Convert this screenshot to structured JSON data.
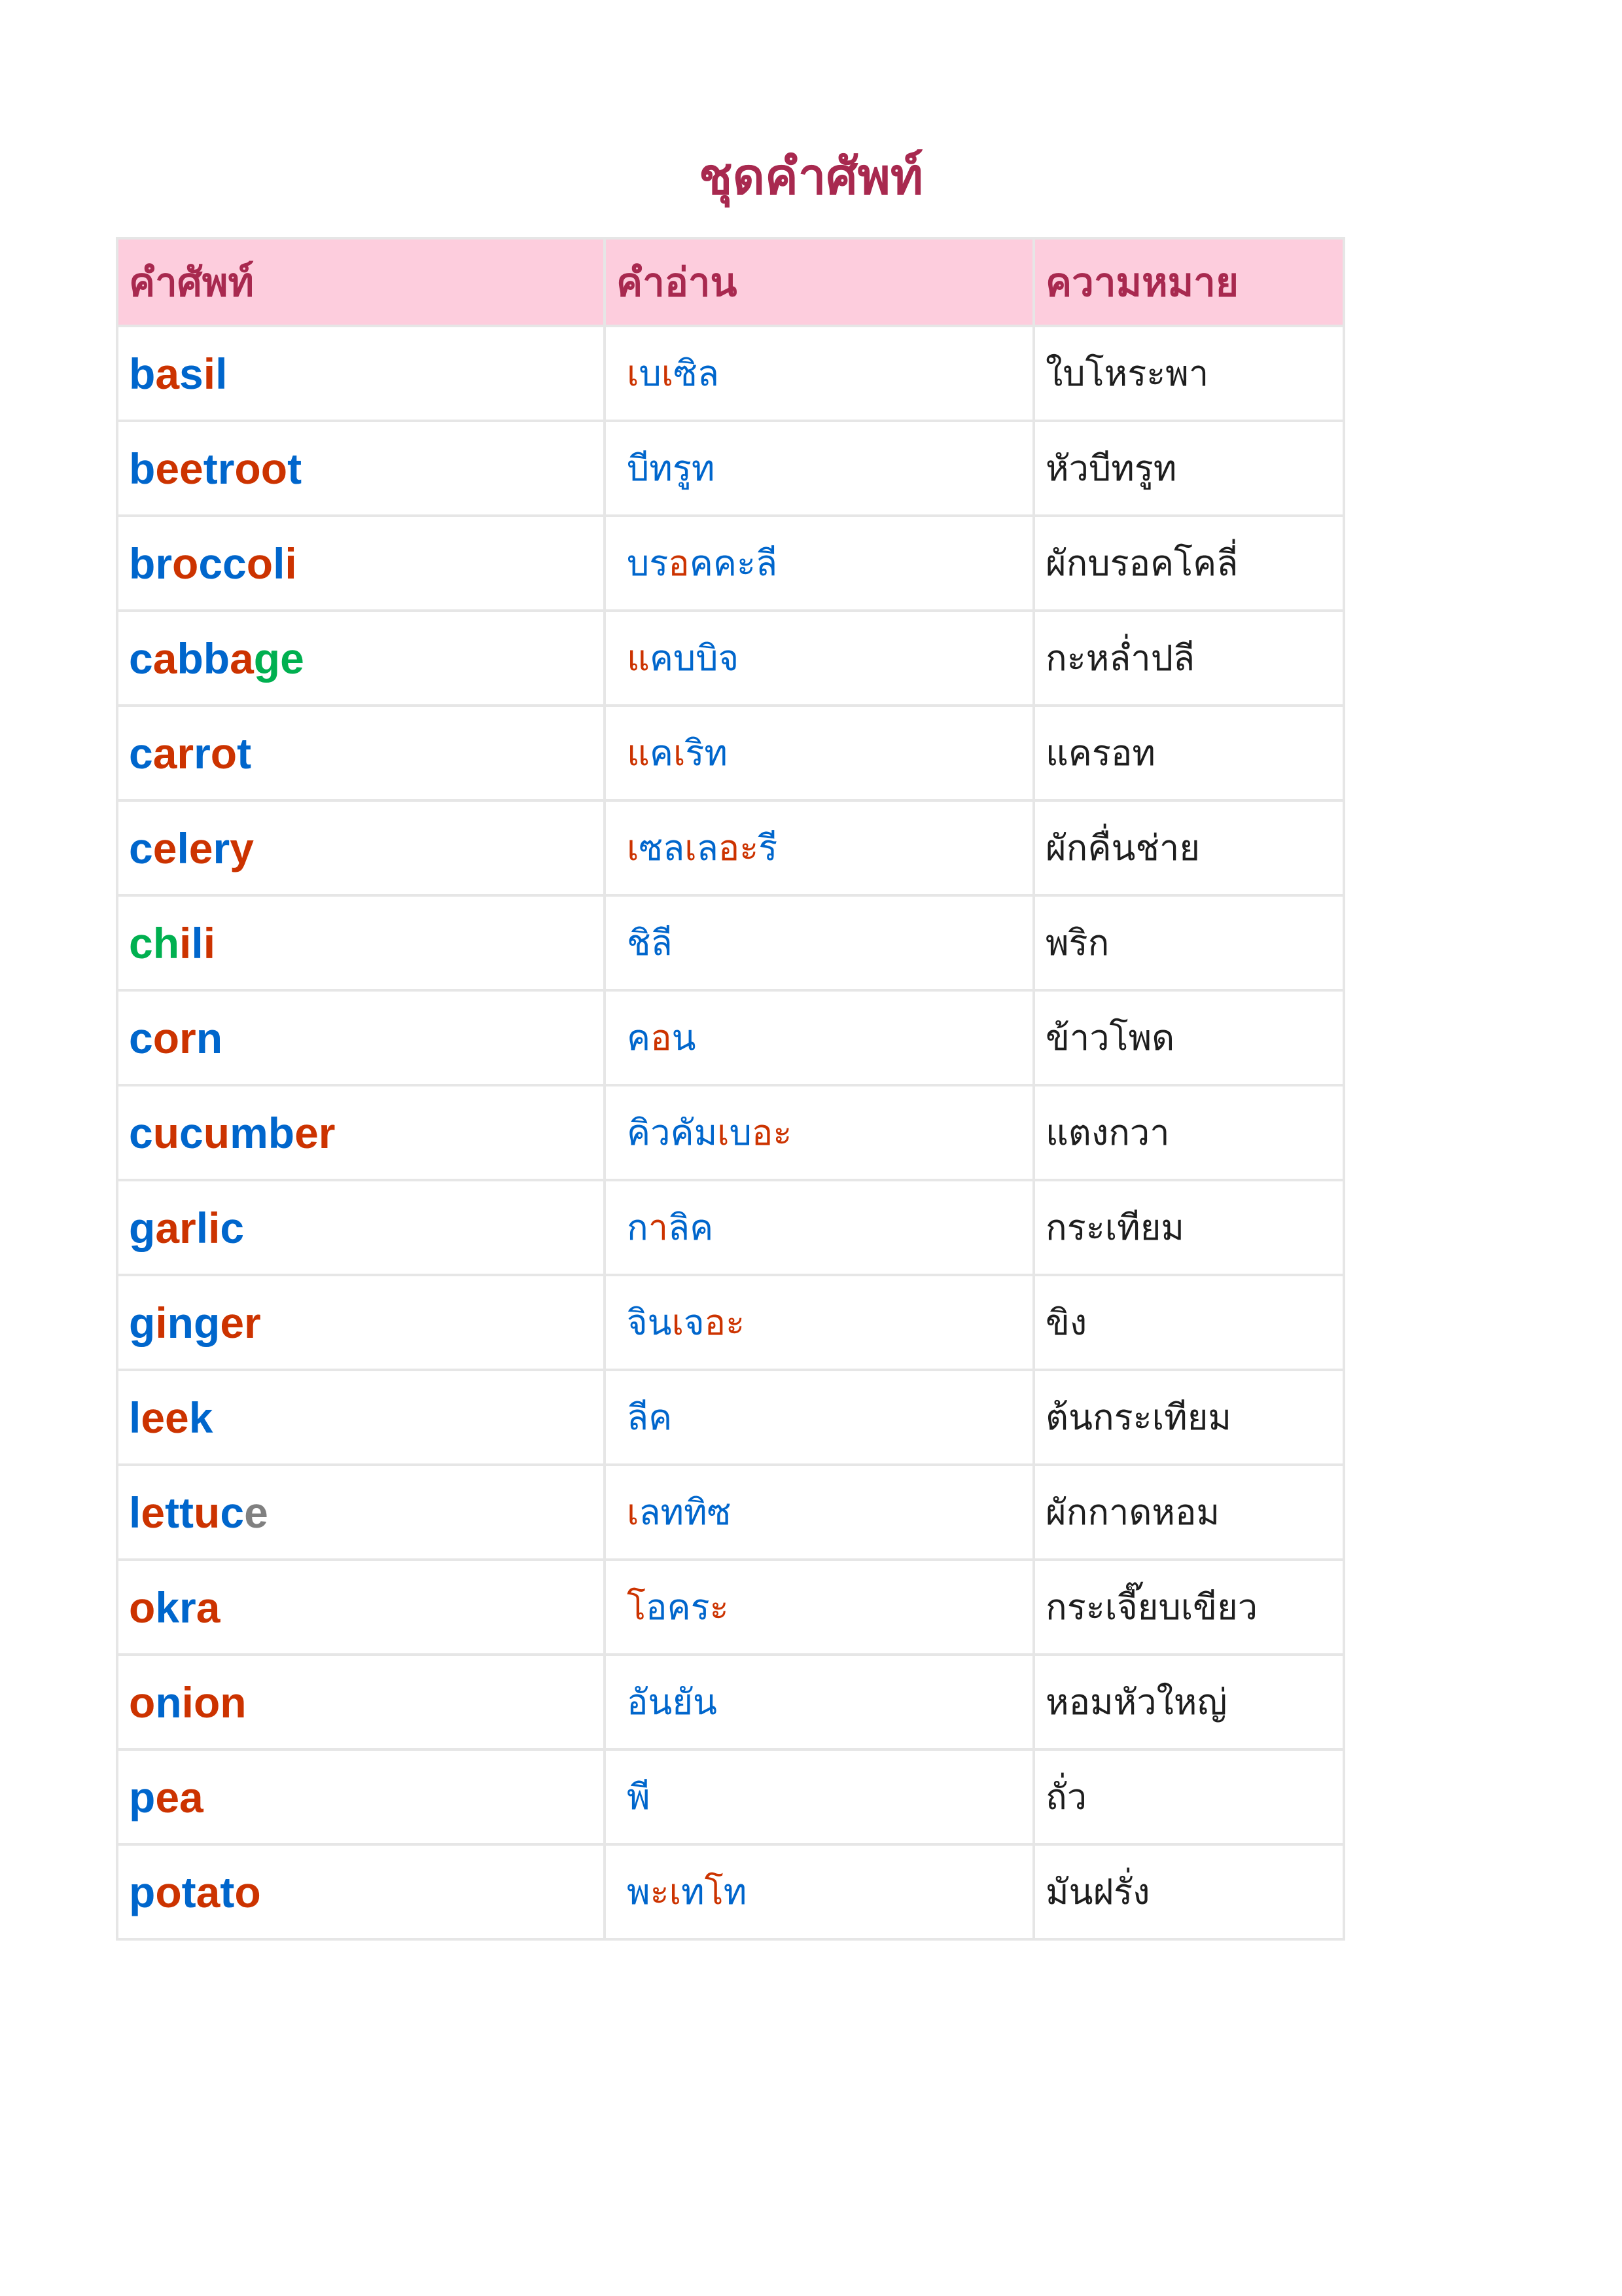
{
  "title": "ชุดคำศัพท์",
  "colors": {
    "title": "#a8294f",
    "header_bg": "#fdcddd",
    "border": "#e6e6e6",
    "blue": "#0066cc",
    "red": "#cc3300",
    "green": "#00b050",
    "gray": "#808080",
    "meaning": "#1e1e1e"
  },
  "headers": [
    "คำศัพท์",
    "คำอ่าน",
    "ความหมาย"
  ],
  "rows": [
    {
      "word": [
        [
          "b",
          "blue"
        ],
        [
          "a",
          "red"
        ],
        [
          "s",
          "blue"
        ],
        [
          "i",
          "red"
        ],
        [
          "l",
          "blue"
        ]
      ],
      "pronunciation": [
        [
          "เ",
          "red"
        ],
        [
          "บ",
          "blue"
        ],
        [
          "เ",
          "red"
        ],
        [
          "ซิล",
          "blue"
        ]
      ],
      "meaning": "ใบโหระพา"
    },
    {
      "word": [
        [
          "b",
          "blue"
        ],
        [
          "ee",
          "red"
        ],
        [
          "tr",
          "blue"
        ],
        [
          "oo",
          "red"
        ],
        [
          "t",
          "blue"
        ]
      ],
      "pronunciation": [
        [
          "บีทรูท",
          "blue"
        ]
      ],
      "meaning": "หัวบีทรูท"
    },
    {
      "word": [
        [
          "br",
          "blue"
        ],
        [
          "o",
          "red"
        ],
        [
          "cc",
          "blue"
        ],
        [
          "o",
          "red"
        ],
        [
          "l",
          "blue"
        ],
        [
          "i",
          "red"
        ]
      ],
      "pronunciation": [
        [
          "บร",
          "blue"
        ],
        [
          "อ",
          "red"
        ],
        [
          "คคะลี",
          "blue"
        ]
      ],
      "meaning": "ผักบรอคโคลี่"
    },
    {
      "word": [
        [
          "c",
          "blue"
        ],
        [
          "a",
          "red"
        ],
        [
          "bb",
          "blue"
        ],
        [
          "a",
          "red"
        ],
        [
          "ge",
          "green"
        ]
      ],
      "pronunciation": [
        [
          "แ",
          "red"
        ],
        [
          "คบบิจ",
          "blue"
        ]
      ],
      "meaning": "กะหล่ำปลี"
    },
    {
      "word": [
        [
          "c",
          "blue"
        ],
        [
          "ar",
          "red"
        ],
        [
          "r",
          "blue"
        ],
        [
          "o",
          "red"
        ],
        [
          "t",
          "blue"
        ]
      ],
      "pronunciation": [
        [
          "แ",
          "red"
        ],
        [
          "ค",
          "blue"
        ],
        [
          "เ",
          "red"
        ],
        [
          "ริท",
          "blue"
        ]
      ],
      "meaning": "แครอท"
    },
    {
      "word": [
        [
          "c",
          "blue"
        ],
        [
          "e",
          "red"
        ],
        [
          "l",
          "blue"
        ],
        [
          "e",
          "red"
        ],
        [
          "r",
          "blue"
        ],
        [
          "y",
          "red"
        ]
      ],
      "pronunciation": [
        [
          "เ",
          "red"
        ],
        [
          "ซล",
          "blue"
        ],
        [
          "เ",
          "red"
        ],
        [
          "ล",
          "blue"
        ],
        [
          "อะ",
          "red"
        ],
        [
          "รี",
          "blue"
        ]
      ],
      "meaning": "ผักคื่นช่าย"
    },
    {
      "word": [
        [
          "ch",
          "green"
        ],
        [
          "i",
          "red"
        ],
        [
          "l",
          "blue"
        ],
        [
          "i",
          "red"
        ]
      ],
      "pronunciation": [
        [
          "ชิลี",
          "blue"
        ]
      ],
      "meaning": "พริก"
    },
    {
      "word": [
        [
          "c",
          "blue"
        ],
        [
          "or",
          "red"
        ],
        [
          "n",
          "blue"
        ]
      ],
      "pronunciation": [
        [
          "ค",
          "blue"
        ],
        [
          "อ",
          "red"
        ],
        [
          "น",
          "blue"
        ]
      ],
      "meaning": "ข้าวโพด"
    },
    {
      "word": [
        [
          "c",
          "blue"
        ],
        [
          "u",
          "red"
        ],
        [
          "c",
          "blue"
        ],
        [
          "u",
          "red"
        ],
        [
          "mb",
          "blue"
        ],
        [
          "er",
          "red"
        ]
      ],
      "pronunciation": [
        [
          "คิวคัม",
          "blue"
        ],
        [
          "เ",
          "red"
        ],
        [
          "บ",
          "blue"
        ],
        [
          "อะ",
          "red"
        ]
      ],
      "meaning": "แตงกวา"
    },
    {
      "word": [
        [
          "g",
          "blue"
        ],
        [
          "ar",
          "red"
        ],
        [
          "l",
          "blue"
        ],
        [
          "i",
          "red"
        ],
        [
          "c",
          "blue"
        ]
      ],
      "pronunciation": [
        [
          "ก",
          "blue"
        ],
        [
          "า",
          "red"
        ],
        [
          "ลิค",
          "blue"
        ]
      ],
      "meaning": "กระเทียม"
    },
    {
      "word": [
        [
          "g",
          "blue"
        ],
        [
          "i",
          "red"
        ],
        [
          "ng",
          "blue"
        ],
        [
          "er",
          "red"
        ]
      ],
      "pronunciation": [
        [
          "จิน",
          "blue"
        ],
        [
          "เ",
          "red"
        ],
        [
          "จ",
          "blue"
        ],
        [
          "อะ",
          "red"
        ]
      ],
      "meaning": "ขิง"
    },
    {
      "word": [
        [
          "l",
          "blue"
        ],
        [
          "ee",
          "red"
        ],
        [
          "k",
          "blue"
        ]
      ],
      "pronunciation": [
        [
          "ลีค",
          "blue"
        ]
      ],
      "meaning": "ต้นกระเทียม"
    },
    {
      "word": [
        [
          "l",
          "blue"
        ],
        [
          "e",
          "red"
        ],
        [
          "tt",
          "blue"
        ],
        [
          "u",
          "red"
        ],
        [
          "c",
          "blue"
        ],
        [
          "e",
          "gray"
        ]
      ],
      "pronunciation": [
        [
          "เ",
          "red"
        ],
        [
          "ลททิซ",
          "blue"
        ]
      ],
      "meaning": "ผักกาดหอม"
    },
    {
      "word": [
        [
          "o",
          "red"
        ],
        [
          "kr",
          "blue"
        ],
        [
          "a",
          "red"
        ]
      ],
      "pronunciation": [
        [
          "โ",
          "red"
        ],
        [
          "อคร",
          "blue"
        ],
        [
          "ะ",
          "red"
        ]
      ],
      "meaning": "กระเจี๊ยบเขียว"
    },
    {
      "word": [
        [
          "o",
          "red"
        ],
        [
          "n",
          "blue"
        ],
        [
          "ion",
          "red"
        ]
      ],
      "pronunciation": [
        [
          "อันยัน",
          "blue"
        ]
      ],
      "meaning": "หอมหัวใหญ่"
    },
    {
      "word": [
        [
          "p",
          "blue"
        ],
        [
          "ea",
          "red"
        ]
      ],
      "pronunciation": [
        [
          "พี",
          "blue"
        ]
      ],
      "meaning": "ถั่ว"
    },
    {
      "word": [
        [
          "p",
          "blue"
        ],
        [
          "o",
          "red"
        ],
        [
          "t",
          "blue"
        ],
        [
          "a",
          "red"
        ],
        [
          "t",
          "blue"
        ],
        [
          "o",
          "red"
        ]
      ],
      "pronunciation": [
        [
          "พ",
          "blue"
        ],
        [
          "ะ",
          "red"
        ],
        [
          "เ",
          "red"
        ],
        [
          "ท",
          "blue"
        ],
        [
          "โ",
          "red"
        ],
        [
          "ท",
          "blue"
        ]
      ],
      "meaning": "มันฝรั่ง"
    }
  ]
}
